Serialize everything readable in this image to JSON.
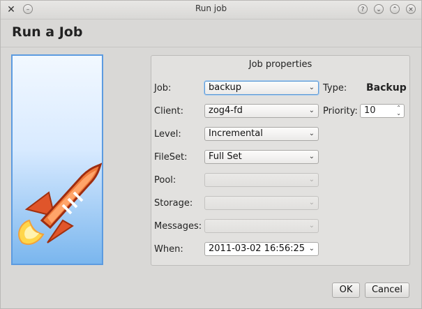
{
  "window": {
    "title": "Run job"
  },
  "page": {
    "heading": "Run a Job"
  },
  "group": {
    "title": "Job properties",
    "fields": {
      "job": {
        "label": "Job:",
        "value": "backup"
      },
      "client": {
        "label": "Client:",
        "value": "zog4-fd"
      },
      "level": {
        "label": "Level:",
        "value": "Incremental"
      },
      "fileset": {
        "label": "FileSet:",
        "value": "Full Set"
      },
      "pool": {
        "label": "Pool:",
        "value": ""
      },
      "storage": {
        "label": "Storage:",
        "value": ""
      },
      "messages": {
        "label": "Messages:",
        "value": ""
      },
      "when": {
        "label": "When:",
        "value": "2011-03-02 16:56:25"
      }
    },
    "type": {
      "label": "Type:",
      "value": "Backup"
    },
    "priority": {
      "label": "Priority:",
      "value": "10"
    }
  },
  "buttons": {
    "ok": "OK",
    "cancel": "Cancel"
  },
  "icons": {
    "app": "app-x-icon",
    "help": "help-icon",
    "minimize": "minimize-icon",
    "maximize": "maximize-icon",
    "close": "close-icon",
    "image": "rocket-image"
  }
}
